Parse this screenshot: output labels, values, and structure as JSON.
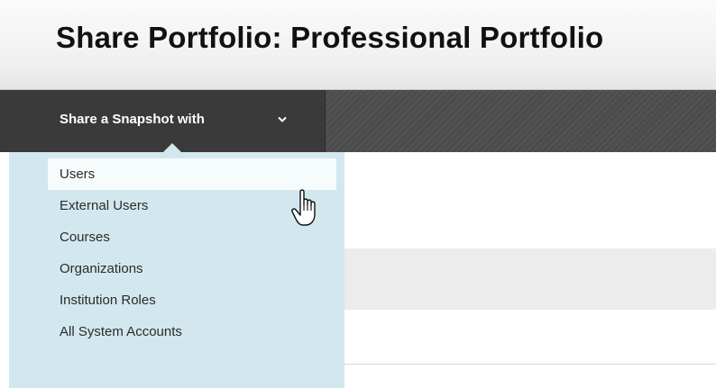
{
  "header": {
    "title": "Share Portfolio: Professional Portfolio"
  },
  "action_bar": {
    "share_button_label": "Share a Snapshot with",
    "share_button_icon": "chevron-down-icon"
  },
  "dropdown": {
    "items": [
      {
        "label": "Users",
        "highlighted": true
      },
      {
        "label": "External Users"
      },
      {
        "label": "Courses"
      },
      {
        "label": "Organizations"
      },
      {
        "label": "Institution Roles"
      },
      {
        "label": "All System Accounts"
      }
    ],
    "background_color": "#d3e8ee",
    "highlight_color": "#f6fbfc"
  },
  "cursor": {
    "icon": "hand-cursor-icon"
  },
  "colors": {
    "action_bar": "#4b4b4b",
    "share_button": "#3a3a3a",
    "title_text": "#111111"
  }
}
